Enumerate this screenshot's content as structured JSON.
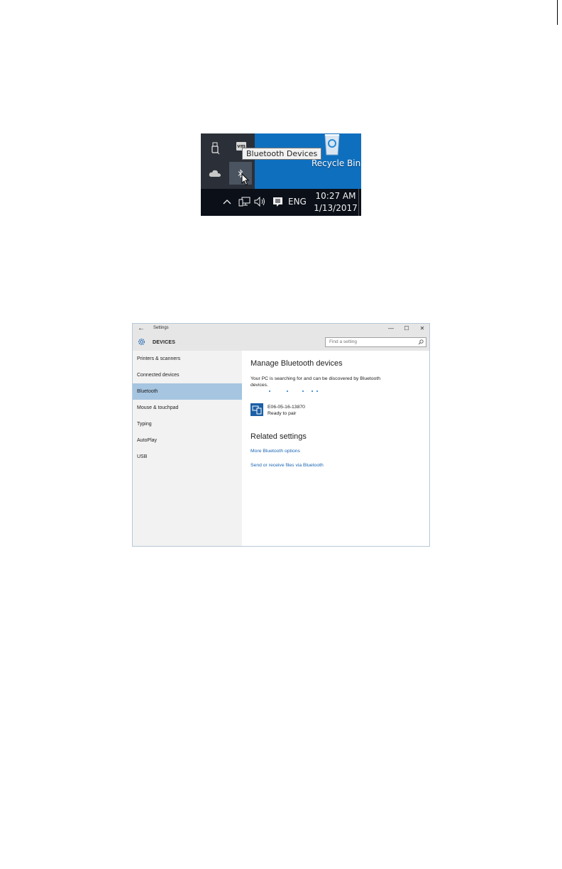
{
  "tray_screenshot": {
    "tooltip": "Bluetooth Devices",
    "recycle_bin_label": "Recycle Bin",
    "vm_icon_text": "vm",
    "language": "ENG",
    "time": "10:27 AM",
    "date": "1/13/2017",
    "icons": [
      "usb-icon",
      "vmware-icon",
      "onedrive-cloud-icon",
      "bluetooth-icon",
      "mouse-cursor-icon",
      "recycle-bin-icon",
      "chevron-up-icon",
      "network-icon",
      "volume-icon",
      "notification-icon"
    ]
  },
  "settings_window": {
    "title": "Settings",
    "header": "DEVICES",
    "search_placeholder": "Find a setting",
    "sidebar": {
      "items": [
        {
          "label": "Printers & scanners"
        },
        {
          "label": "Connected devices"
        },
        {
          "label": "Bluetooth"
        },
        {
          "label": "Mouse & touchpad"
        },
        {
          "label": "Typing"
        },
        {
          "label": "AutoPlay"
        },
        {
          "label": "USB"
        }
      ],
      "selected": "Bluetooth"
    },
    "main": {
      "heading": "Manage Bluetooth devices",
      "description": "Your PC is searching for and can be discovered by Bluetooth devices.",
      "device": {
        "name": "E06-05-16-13870",
        "status": "Ready to pair"
      },
      "related_heading": "Related settings",
      "links": [
        "More Bluetooth options",
        "Send or receive files via Bluetooth"
      ]
    }
  },
  "colors": {
    "desktop_blue": "#0f6fbf",
    "taskbar": "#0a0f18",
    "selected_nav": "#a6c5e1",
    "link": "#1a64b4",
    "device_icon": "#1b5fa6"
  }
}
